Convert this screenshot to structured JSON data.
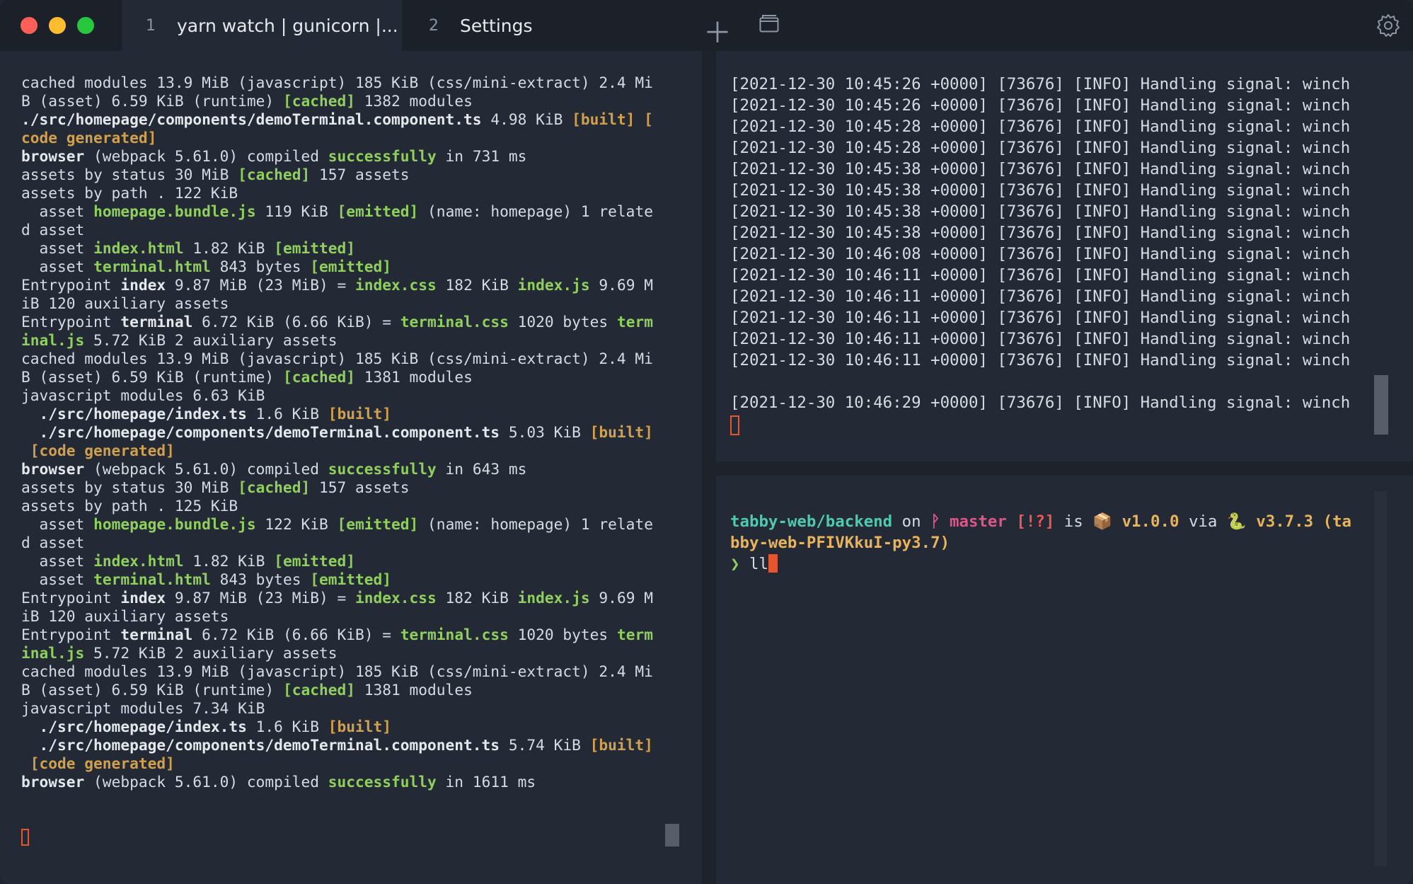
{
  "tabs": [
    {
      "number": "1",
      "title": "yarn watch | gunicorn |..."
    },
    {
      "number": "2",
      "title": "Settings"
    }
  ],
  "toolbar": {
    "new_tab_icon": "plus-icon",
    "window_icon": "window-icon",
    "settings_icon": "gear-icon"
  },
  "colors": {
    "background": "#242a35",
    "titlebar": "#1b2029",
    "text": "#d6dbe3",
    "green": "#8fcf5c",
    "yellow": "#d1a04c",
    "cyan": "#4fc9b0",
    "magenta": "#e05488",
    "cursor": "#e4572e"
  },
  "left_pane": {
    "lines": [
      [
        [
          "cached modules 13.9 MiB (javascript) 185 KiB (css/mini-extract) 2.4 Mi",
          ""
        ]
      ],
      [
        [
          "B (asset) 6.59 KiB (runtime) ",
          ""
        ],
        [
          "[cached]",
          "g"
        ],
        [
          " 1382 modules",
          ""
        ]
      ],
      [
        [
          "./src/homepage/components/demoTerminal.component.ts",
          "w"
        ],
        [
          " 4.98 KiB ",
          ""
        ],
        [
          "[built]",
          "y"
        ],
        [
          " [",
          "y"
        ]
      ],
      [
        [
          "code generated]",
          "y"
        ]
      ],
      [
        [
          "browser",
          "w"
        ],
        [
          " (webpack 5.61.0) compiled ",
          ""
        ],
        [
          "successfully",
          "g"
        ],
        [
          " in 731 ms",
          ""
        ]
      ],
      [
        [
          "assets by status 30 MiB ",
          ""
        ],
        [
          "[cached]",
          "g"
        ],
        [
          " 157 assets",
          ""
        ]
      ],
      [
        [
          "assets by path . 122 KiB",
          ""
        ]
      ],
      [
        [
          "  asset ",
          ""
        ],
        [
          "homepage.bundle.js",
          "g"
        ],
        [
          " 119 KiB ",
          ""
        ],
        [
          "[emitted]",
          "g"
        ],
        [
          " (name: homepage) 1 relate",
          ""
        ]
      ],
      [
        [
          "d asset",
          ""
        ]
      ],
      [
        [
          "  asset ",
          ""
        ],
        [
          "index.html",
          "g"
        ],
        [
          " 1.82 KiB ",
          ""
        ],
        [
          "[emitted]",
          "g"
        ]
      ],
      [
        [
          "  asset ",
          ""
        ],
        [
          "terminal.html",
          "g"
        ],
        [
          " 843 bytes ",
          ""
        ],
        [
          "[emitted]",
          "g"
        ]
      ],
      [
        [
          "Entrypoint ",
          ""
        ],
        [
          "index",
          "w"
        ],
        [
          " 9.87 MiB (23 MiB) = ",
          ""
        ],
        [
          "index.css",
          "g"
        ],
        [
          " 182 KiB ",
          ""
        ],
        [
          "index.js",
          "g"
        ],
        [
          " 9.69 M",
          ""
        ]
      ],
      [
        [
          "iB 120 auxiliary assets",
          ""
        ]
      ],
      [
        [
          "Entrypoint ",
          ""
        ],
        [
          "terminal",
          "w"
        ],
        [
          " 6.72 KiB (6.66 KiB) = ",
          ""
        ],
        [
          "terminal.css",
          "g"
        ],
        [
          " 1020 bytes ",
          ""
        ],
        [
          "term",
          "g"
        ]
      ],
      [
        [
          "inal.js",
          "g"
        ],
        [
          " 5.72 KiB 2 auxiliary assets",
          ""
        ]
      ],
      [
        [
          "cached modules 13.9 MiB (javascript) 185 KiB (css/mini-extract) 2.4 Mi",
          ""
        ]
      ],
      [
        [
          "B (asset) 6.59 KiB (runtime) ",
          ""
        ],
        [
          "[cached]",
          "g"
        ],
        [
          " 1381 modules",
          ""
        ]
      ],
      [
        [
          "javascript modules 6.63 KiB",
          ""
        ]
      ],
      [
        [
          "  ./src/homepage/index.ts",
          "w"
        ],
        [
          " 1.6 KiB ",
          ""
        ],
        [
          "[built]",
          "y"
        ]
      ],
      [
        [
          "  ./src/homepage/components/demoTerminal.component.ts",
          "w"
        ],
        [
          " 5.03 KiB ",
          ""
        ],
        [
          "[built]",
          "y"
        ]
      ],
      [
        [
          " [code generated]",
          "y"
        ]
      ],
      [
        [
          "browser",
          "w"
        ],
        [
          " (webpack 5.61.0) compiled ",
          ""
        ],
        [
          "successfully",
          "g"
        ],
        [
          " in 643 ms",
          ""
        ]
      ],
      [
        [
          "assets by status 30 MiB ",
          ""
        ],
        [
          "[cached]",
          "g"
        ],
        [
          " 157 assets",
          ""
        ]
      ],
      [
        [
          "assets by path . 125 KiB",
          ""
        ]
      ],
      [
        [
          "  asset ",
          ""
        ],
        [
          "homepage.bundle.js",
          "g"
        ],
        [
          " 122 KiB ",
          ""
        ],
        [
          "[emitted]",
          "g"
        ],
        [
          " (name: homepage) 1 relate",
          ""
        ]
      ],
      [
        [
          "d asset",
          ""
        ]
      ],
      [
        [
          "  asset ",
          ""
        ],
        [
          "index.html",
          "g"
        ],
        [
          " 1.82 KiB ",
          ""
        ],
        [
          "[emitted]",
          "g"
        ]
      ],
      [
        [
          "  asset ",
          ""
        ],
        [
          "terminal.html",
          "g"
        ],
        [
          " 843 bytes ",
          ""
        ],
        [
          "[emitted]",
          "g"
        ]
      ],
      [
        [
          "Entrypoint ",
          ""
        ],
        [
          "index",
          "w"
        ],
        [
          " 9.87 MiB (23 MiB) = ",
          ""
        ],
        [
          "index.css",
          "g"
        ],
        [
          " 182 KiB ",
          ""
        ],
        [
          "index.js",
          "g"
        ],
        [
          " 9.69 M",
          ""
        ]
      ],
      [
        [
          "iB 120 auxiliary assets",
          ""
        ]
      ],
      [
        [
          "Entrypoint ",
          ""
        ],
        [
          "terminal",
          "w"
        ],
        [
          " 6.72 KiB (6.66 KiB) = ",
          ""
        ],
        [
          "terminal.css",
          "g"
        ],
        [
          " 1020 bytes ",
          ""
        ],
        [
          "term",
          "g"
        ]
      ],
      [
        [
          "inal.js",
          "g"
        ],
        [
          " 5.72 KiB 2 auxiliary assets",
          ""
        ]
      ],
      [
        [
          "cached modules 13.9 MiB (javascript) 185 KiB (css/mini-extract) 2.4 Mi",
          ""
        ]
      ],
      [
        [
          "B (asset) 6.59 KiB (runtime) ",
          ""
        ],
        [
          "[cached]",
          "g"
        ],
        [
          " 1381 modules",
          ""
        ]
      ],
      [
        [
          "javascript modules 7.34 KiB",
          ""
        ]
      ],
      [
        [
          "  ./src/homepage/index.ts",
          "w"
        ],
        [
          " 1.6 KiB ",
          ""
        ],
        [
          "[built]",
          "y"
        ]
      ],
      [
        [
          "  ./src/homepage/components/demoTerminal.component.ts",
          "w"
        ],
        [
          " 5.74 KiB ",
          ""
        ],
        [
          "[built]",
          "y"
        ]
      ],
      [
        [
          " [code generated]",
          "y"
        ]
      ],
      [
        [
          "browser",
          "w"
        ],
        [
          " (webpack 5.61.0) compiled ",
          ""
        ],
        [
          "successfully",
          "g"
        ],
        [
          " in 1611 ms",
          ""
        ]
      ]
    ]
  },
  "right_top_pane": {
    "lines": [
      "[2021-12-30 10:45:26 +0000] [73676] [INFO] Handling signal: winch",
      "[2021-12-30 10:45:26 +0000] [73676] [INFO] Handling signal: winch",
      "[2021-12-30 10:45:28 +0000] [73676] [INFO] Handling signal: winch",
      "[2021-12-30 10:45:28 +0000] [73676] [INFO] Handling signal: winch",
      "[2021-12-30 10:45:38 +0000] [73676] [INFO] Handling signal: winch",
      "[2021-12-30 10:45:38 +0000] [73676] [INFO] Handling signal: winch",
      "[2021-12-30 10:45:38 +0000] [73676] [INFO] Handling signal: winch",
      "[2021-12-30 10:45:38 +0000] [73676] [INFO] Handling signal: winch",
      "[2021-12-30 10:46:08 +0000] [73676] [INFO] Handling signal: winch",
      "[2021-12-30 10:46:11 +0000] [73676] [INFO] Handling signal: winch",
      "[2021-12-30 10:46:11 +0000] [73676] [INFO] Handling signal: winch",
      "[2021-12-30 10:46:11 +0000] [73676] [INFO] Handling signal: winch",
      "[2021-12-30 10:46:11 +0000] [73676] [INFO] Handling signal: winch",
      "[2021-12-30 10:46:11 +0000] [73676] [INFO] Handling signal: winch",
      "",
      "[2021-12-30 10:46:29 +0000] [73676] [INFO] Handling signal: winch"
    ]
  },
  "right_bottom_pane": {
    "lines": [
      [
        [
          "tabby-web/backend",
          "cy"
        ],
        [
          " on ",
          ""
        ],
        [
          "ᚹ master",
          "mg"
        ],
        [
          " ",
          ""
        ],
        [
          "[!?]",
          "rd"
        ],
        [
          " is 📦 ",
          ""
        ],
        [
          "v1.0.0",
          "yl"
        ],
        [
          " via 🐍 ",
          ""
        ],
        [
          "v3.7.3 (ta",
          "yl"
        ]
      ],
      [
        [
          "bby-web-PFIVKkuI-py3.7)",
          "yl"
        ]
      ],
      [
        [
          "❯ ",
          "gg"
        ],
        [
          "ll",
          ""
        ]
      ]
    ]
  }
}
